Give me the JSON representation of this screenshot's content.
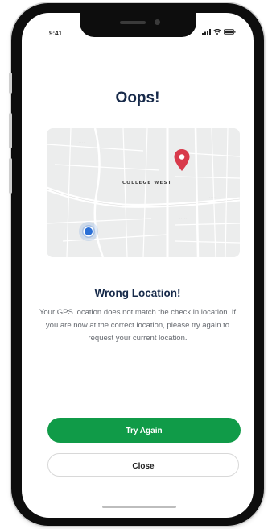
{
  "status_bar": {
    "time": "9:41",
    "icons": [
      "signal-icon",
      "wifi-icon",
      "battery-icon"
    ]
  },
  "title": "Oops!",
  "map": {
    "label": "COLLEGE WEST",
    "pin_icon": "location-pin-icon",
    "current_location_icon": "current-location-dot-icon",
    "pin_color": "#d83a4b",
    "dot_color": "#2a6fd6"
  },
  "subtitle": "Wrong Location!",
  "message": "Your GPS location does not match the check in location. If you are now at the correct location, please try again to request your current location.",
  "buttons": {
    "try_again": "Try Again",
    "close": "Close"
  },
  "colors": {
    "primary": "#109b48",
    "heading": "#172a4a",
    "body_text": "#666a70"
  }
}
